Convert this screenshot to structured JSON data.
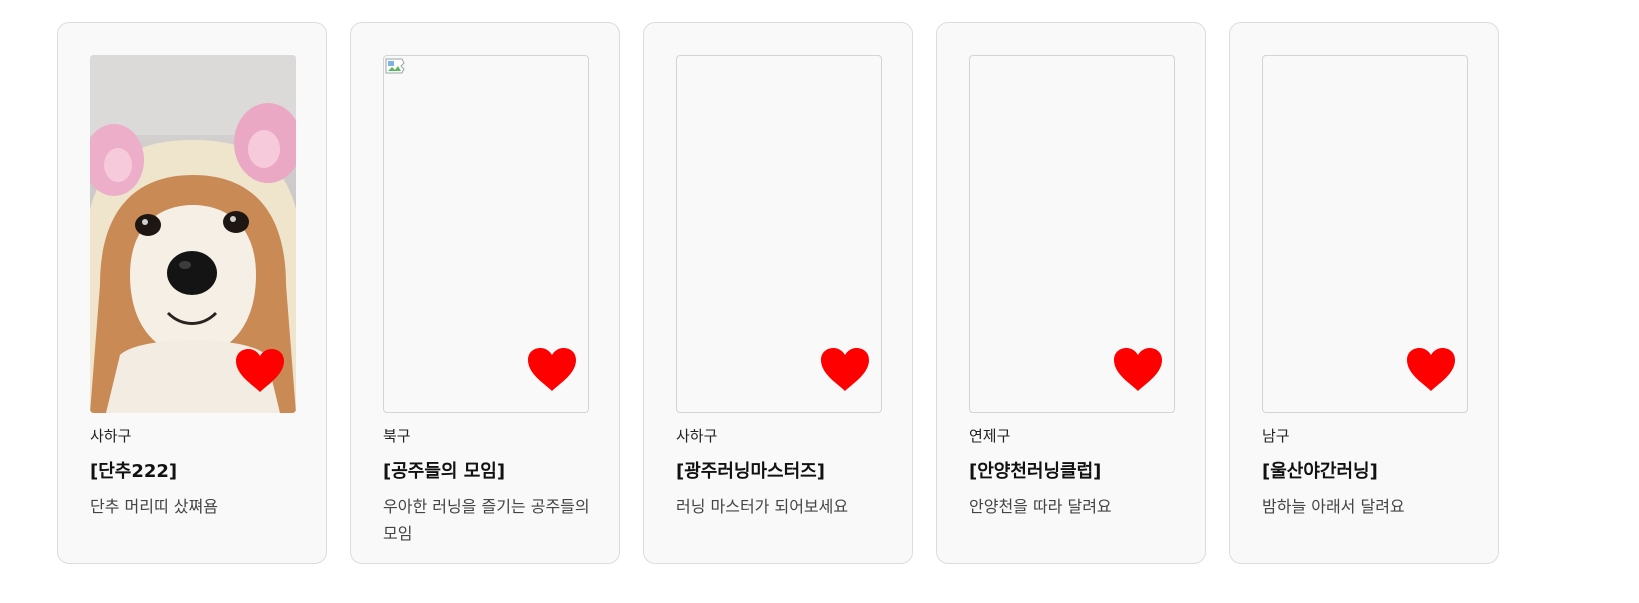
{
  "colors": {
    "heart": "#ff0000",
    "card_bg": "#f9f9f9",
    "card_border": "#dcdcdc"
  },
  "cards": [
    {
      "region": "사하구",
      "title": "[단추222]",
      "desc": "단추 머리띠 샀쪄욤",
      "image": "shiba-inu-photo",
      "like_icon": "heart-icon"
    },
    {
      "region": "북구",
      "title": "[공주들의 모임]",
      "desc": "우아한 러닝을 즐기는 공주들의 모임",
      "image": "broken-image-icon",
      "like_icon": "heart-icon"
    },
    {
      "region": "사하구",
      "title": "[광주러닝마스터즈]",
      "desc": "러닝 마스터가 되어보세요",
      "image": "empty",
      "like_icon": "heart-icon"
    },
    {
      "region": "연제구",
      "title": "[안양천러닝클럽]",
      "desc": "안양천을 따라 달려요",
      "image": "empty",
      "like_icon": "heart-icon"
    },
    {
      "region": "남구",
      "title": "[울산야간러닝]",
      "desc": "밤하늘 아래서 달려요",
      "image": "empty",
      "like_icon": "heart-icon"
    }
  ]
}
